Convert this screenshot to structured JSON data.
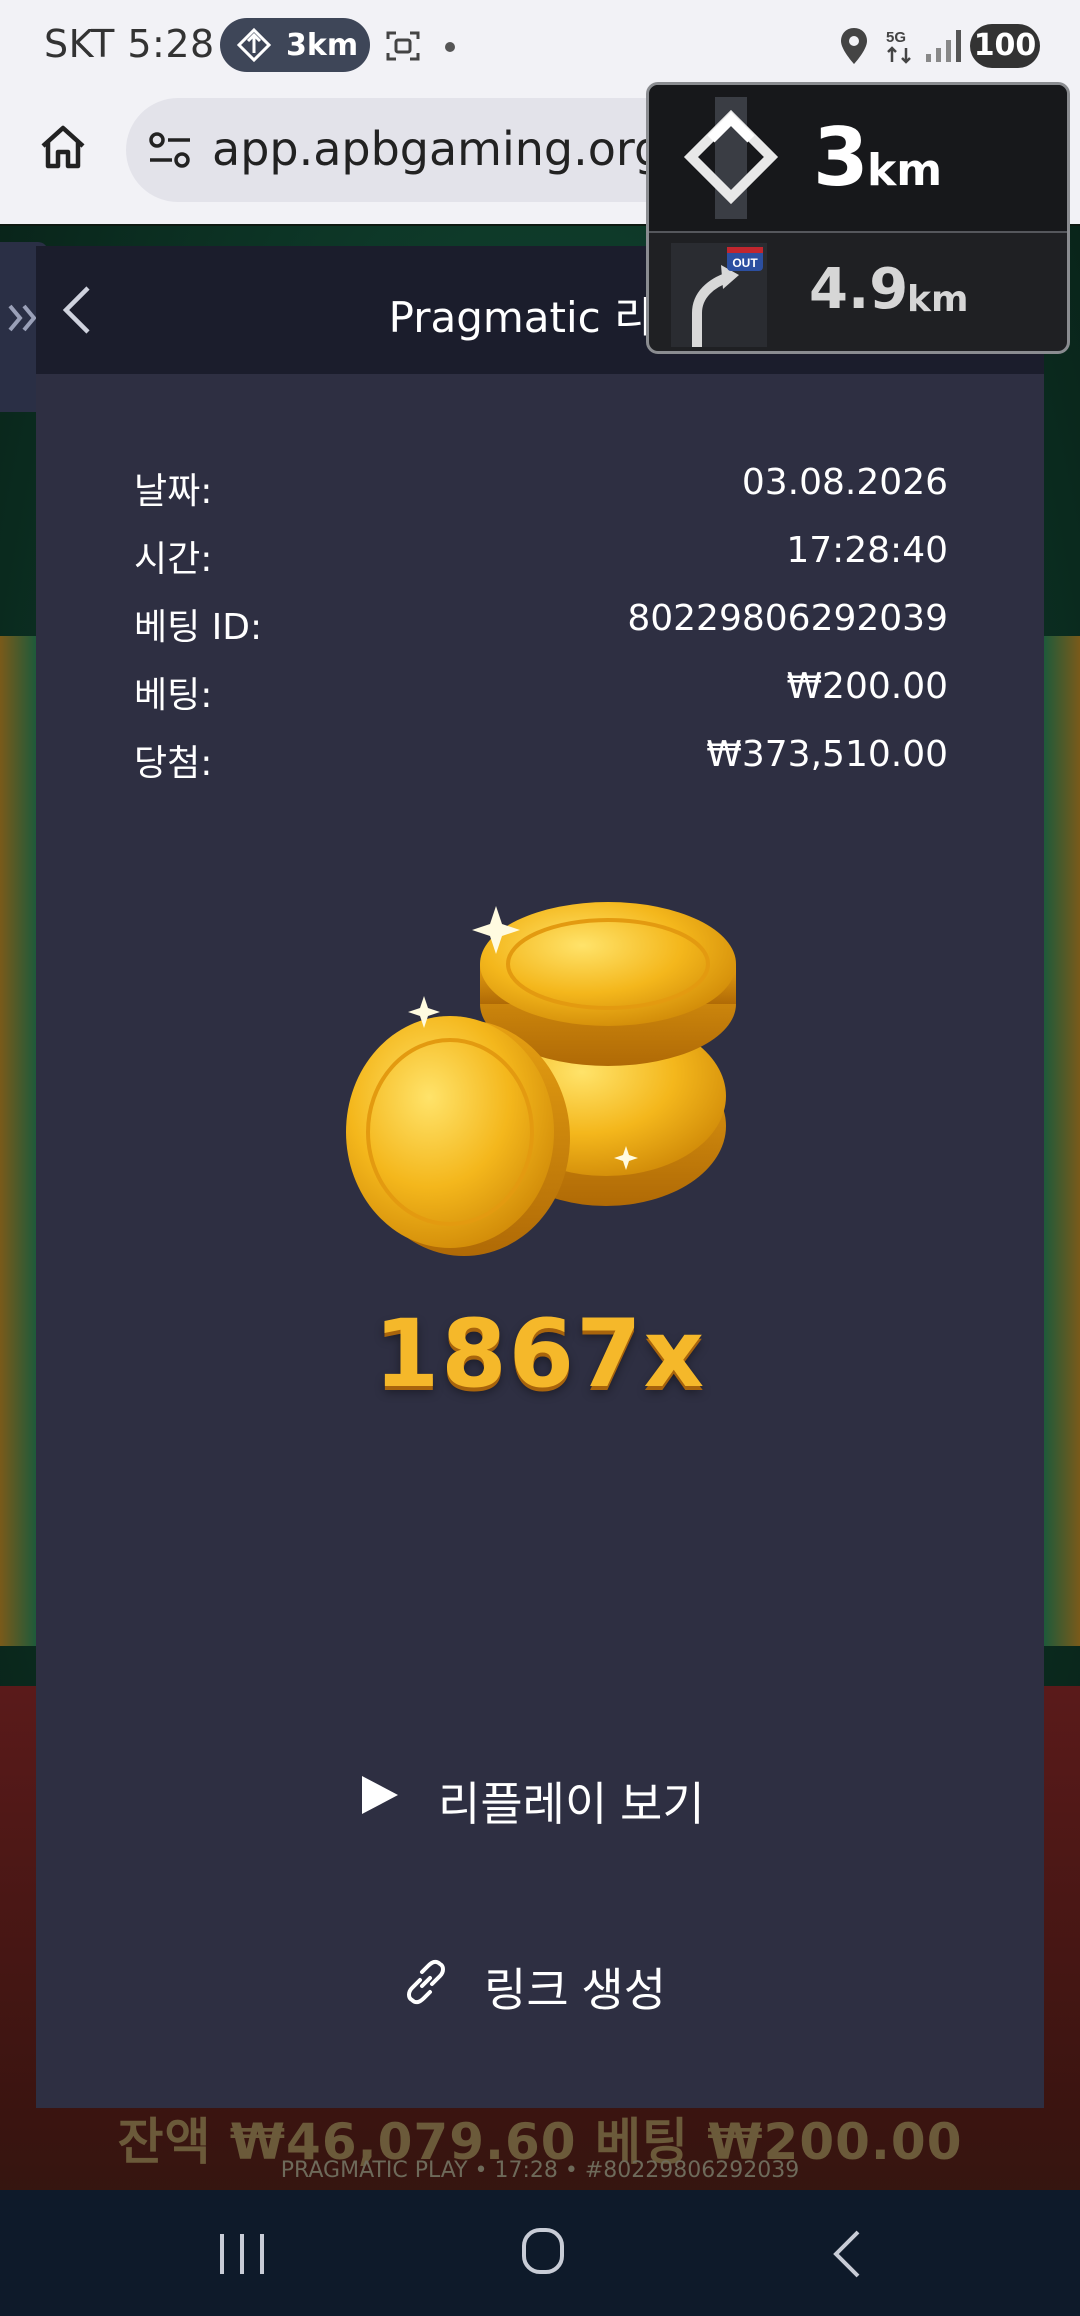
{
  "status_bar": {
    "carrier_time": "SKT 5:28",
    "nav_chip_distance": "3km",
    "battery": "100"
  },
  "browser": {
    "url": "app.apbgaming.org/"
  },
  "panel": {
    "title": "Pragmatic 리플",
    "rows": [
      {
        "label": "날짜:",
        "value": "03.08.2026"
      },
      {
        "label": "시간:",
        "value": "17:28:40"
      },
      {
        "label": "베팅 ID:",
        "value": "80229806292039"
      },
      {
        "label": "베팅:",
        "value": "₩200.00"
      },
      {
        "label": "당첨:",
        "value": "₩373,510.00"
      }
    ],
    "multiplier": "1867x",
    "replay_label": "리플레이 보기",
    "link_label": "링크 생성"
  },
  "background": {
    "balance_text": "잔액 ₩46,079.60  베팅 ₩200.00",
    "meta_text": "PRAGMATIC PLAY • 17:28 • #80229806292039"
  },
  "nav_overlay": {
    "main_distance": "3",
    "main_unit": "km",
    "exit_badge": "OUT",
    "sub_distance": "4.9",
    "sub_unit": "km"
  },
  "colors": {
    "panel_bg": "#2e2f42",
    "header_bg": "#1b1d2c",
    "multiplier_gold": "#f5b82a",
    "status_bar_bg": "#f2f2f6"
  }
}
